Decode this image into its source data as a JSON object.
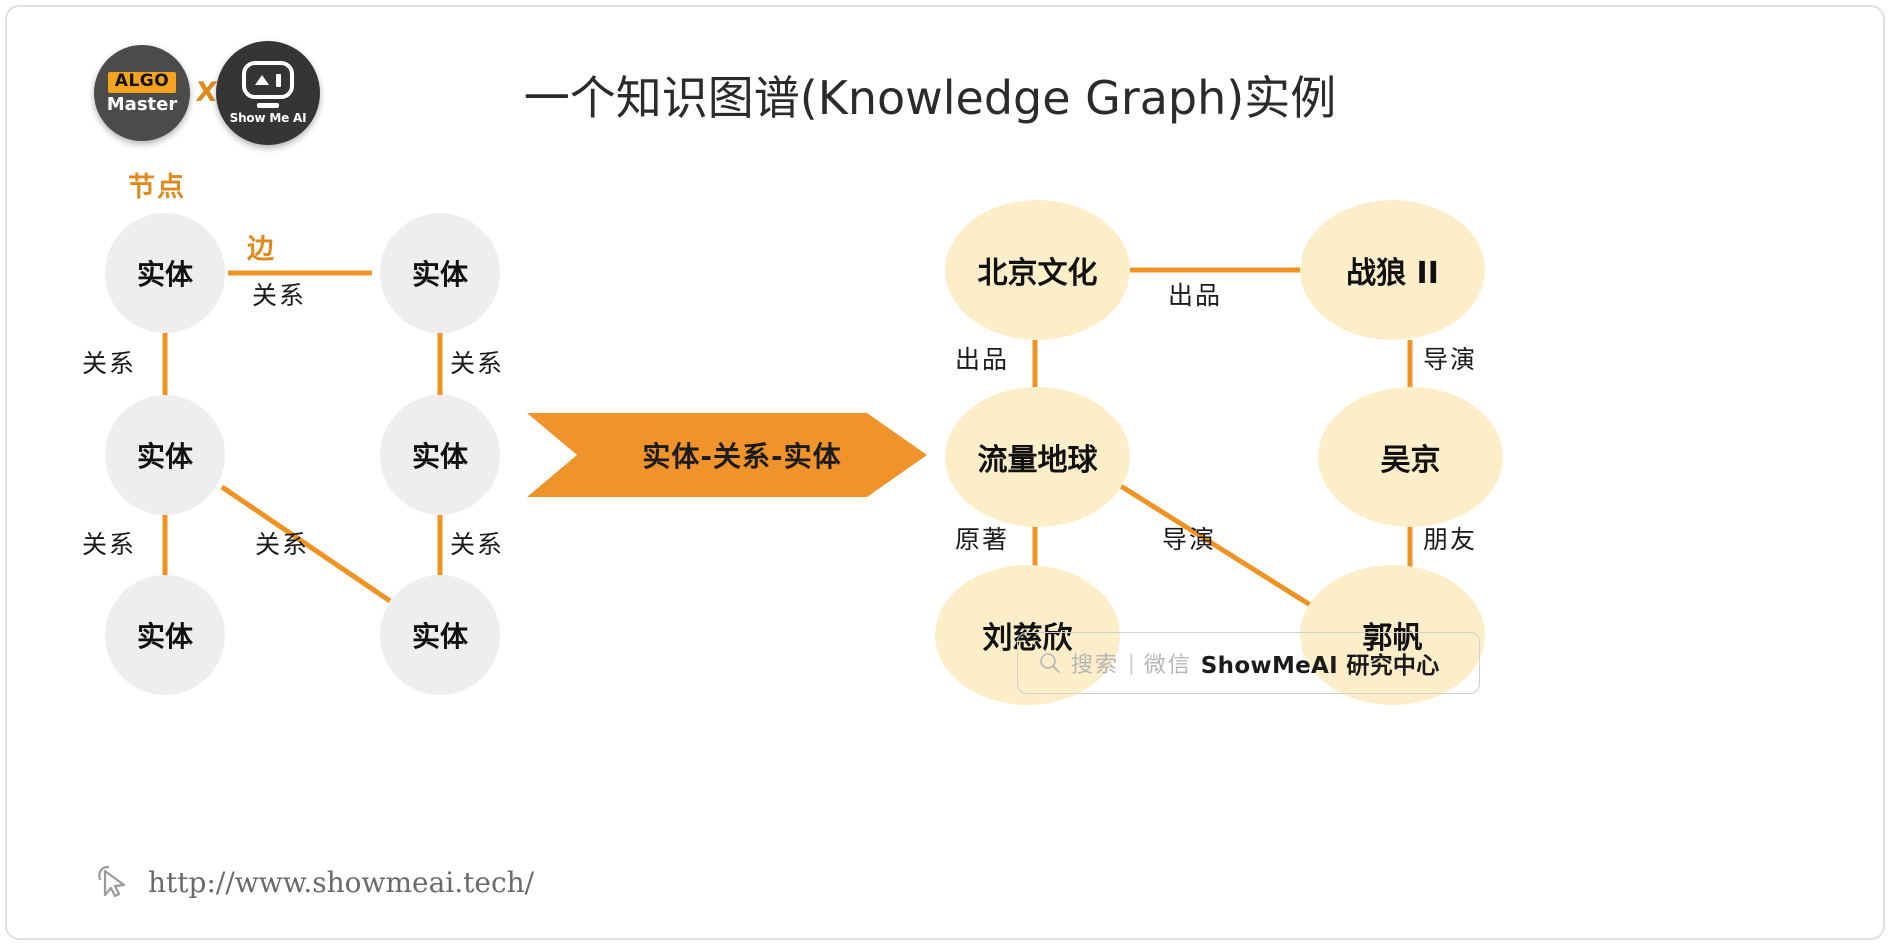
{
  "title": "一个知识图谱(Knowledge Graph)实例",
  "logos": {
    "algo": {
      "tag": "ALGO",
      "sub": "Master"
    },
    "cross": "X",
    "showmeai": {
      "label": "Show Me AI"
    }
  },
  "annotations": {
    "node_label": "节点",
    "edge_label": "边"
  },
  "arrow": {
    "text": "实体-关系-实体",
    "color": "#f0932b"
  },
  "colors": {
    "edge": "#ef9322",
    "gray_node": "#eeeeee",
    "cream_node": "#fceec9",
    "accent": "#e08a1e",
    "text": "#1b1b1b"
  },
  "left_graph": {
    "nodes": [
      {
        "id": "L1",
        "label": "实体"
      },
      {
        "id": "L2",
        "label": "实体"
      },
      {
        "id": "L3",
        "label": "实体"
      },
      {
        "id": "L4",
        "label": "实体"
      },
      {
        "id": "L5",
        "label": "实体"
      },
      {
        "id": "L6",
        "label": "实体"
      }
    ],
    "edges": [
      {
        "from": "L1",
        "to": "L2",
        "label": "关系"
      },
      {
        "from": "L1",
        "to": "L3",
        "label": "关系"
      },
      {
        "from": "L2",
        "to": "L4",
        "label": "关系"
      },
      {
        "from": "L3",
        "to": "L5",
        "label": "关系"
      },
      {
        "from": "L4",
        "to": "L6",
        "label": "关系"
      },
      {
        "from": "L3",
        "to": "L6",
        "label": "关系"
      }
    ]
  },
  "right_graph": {
    "nodes": [
      {
        "id": "R1",
        "label": "北京文化"
      },
      {
        "id": "R2",
        "label": "战狼 II"
      },
      {
        "id": "R3",
        "label": "流量地球"
      },
      {
        "id": "R4",
        "label": "吴京"
      },
      {
        "id": "R5",
        "label": "刘慈欣"
      },
      {
        "id": "R6",
        "label": "郭帆"
      }
    ],
    "edges": [
      {
        "from": "R1",
        "to": "R2",
        "label": "出品"
      },
      {
        "from": "R1",
        "to": "R3",
        "label": "出品"
      },
      {
        "from": "R2",
        "to": "R4",
        "label": "导演"
      },
      {
        "from": "R3",
        "to": "R5",
        "label": "原著"
      },
      {
        "from": "R4",
        "to": "R6",
        "label": "朋友"
      },
      {
        "from": "R3",
        "to": "R6",
        "label": "导演"
      }
    ]
  },
  "watermark": {
    "search": "搜索",
    "separator": "|",
    "wechat": "微信",
    "brand": "ShowMeAI 研究中心"
  },
  "footer": {
    "url": "http://www.showmeai.tech/"
  }
}
